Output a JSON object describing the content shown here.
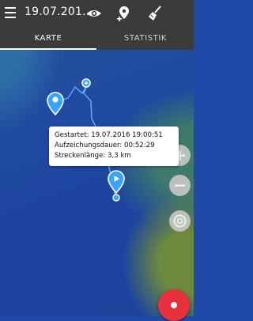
{
  "appbar": {
    "title": "19.07.201…"
  },
  "tabs": [
    {
      "label": "KARTE",
      "active": true
    },
    {
      "label": "STATISTIK",
      "active": false
    }
  ],
  "info": {
    "started": "Gestartet: 19.07.2016 19:00:51",
    "duration": "Aufzeichungsdauer: 00:52:29",
    "distance": "Streckenlänge: 3,3 km"
  },
  "icons": [
    "menu-icon",
    "eye-icon",
    "add-location-icon",
    "broom-icon",
    "zoom-in-icon",
    "zoom-out-icon",
    "locate-icon",
    "record-icon"
  ],
  "colors": {
    "bar": "#3b3b3b",
    "water": "#1f4aa8",
    "record": "#e8313b",
    "track": "#5aa0ff"
  }
}
